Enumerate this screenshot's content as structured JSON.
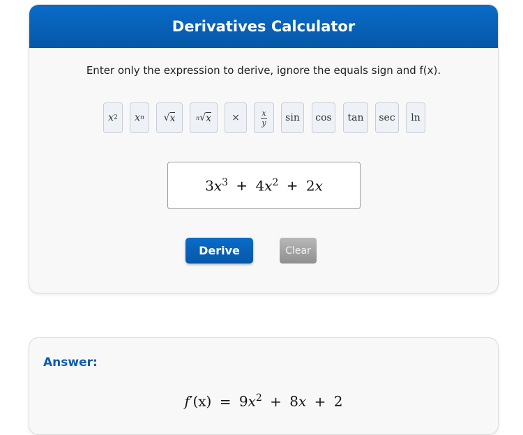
{
  "header": {
    "title": "Derivatives Calculator"
  },
  "instructions": "Enter only the expression to derive, ignore the equals sign and f(x).",
  "toolbar": {
    "keys": {
      "square": {
        "base": "x",
        "exp": "2"
      },
      "power": {
        "base": "x",
        "exp": "n"
      },
      "sqrt": {
        "symbol": "√",
        "arg": "x"
      },
      "nth_root": {
        "index": "n",
        "symbol": "√",
        "arg": "x"
      },
      "times": "×",
      "fraction": {
        "num": "x",
        "den": "y"
      },
      "sin": "sin",
      "cos": "cos",
      "tan": "tan",
      "sec": "sec",
      "ln": "ln"
    }
  },
  "expression": {
    "display": {
      "t1_coef": "3",
      "t1_var": "x",
      "t1_exp": "3",
      "op1": "+",
      "t2_coef": "4",
      "t2_var": "x",
      "t2_exp": "2",
      "op2": "+",
      "t3_coef": "2",
      "t3_var": "x"
    }
  },
  "buttons": {
    "derive": "Derive",
    "clear": "Clear"
  },
  "answer": {
    "label": "Answer:",
    "result": {
      "lhs_f": "f",
      "lhs_prime": "′",
      "lhs_arg": "(x)",
      "eq": "=",
      "t1_coef": "9",
      "t1_var": "x",
      "t1_exp": "2",
      "op1": "+",
      "t2_coef": "8",
      "t2_var": "x",
      "op2": "+",
      "t3": "2"
    }
  },
  "colors": {
    "primary": "#0657a8",
    "answer_label": "#0d5bb0",
    "clear_button": "#9a9a9a"
  }
}
